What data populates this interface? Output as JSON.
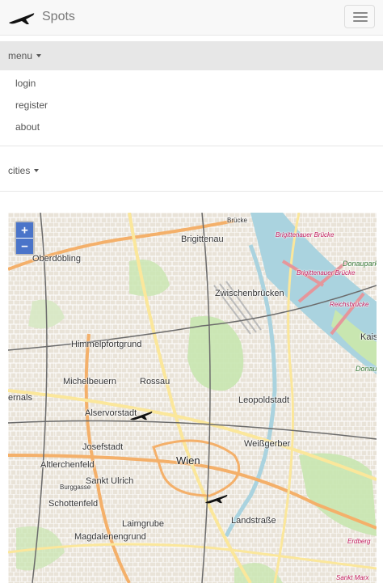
{
  "navbar": {
    "brand": "Spots",
    "brand_icon": "airplane-icon",
    "toggle_icon": "hamburger-icon"
  },
  "menu": {
    "label": "menu",
    "items": [
      {
        "label": "login"
      },
      {
        "label": "register"
      },
      {
        "label": "about"
      }
    ]
  },
  "cities": {
    "label": "cities"
  },
  "map": {
    "zoom_in": "+",
    "zoom_out": "−",
    "labels": [
      {
        "text": "Oberdöbling",
        "cls": ""
      },
      {
        "text": "Brigittenau",
        "cls": ""
      },
      {
        "text": "Brücke",
        "cls": "small"
      },
      {
        "text": "Brigittenauer Brücke",
        "cls": "red"
      },
      {
        "text": "Brigittenauer Brücke",
        "cls": "red"
      },
      {
        "text": "Zwischenbrücken",
        "cls": ""
      },
      {
        "text": "Reichsbrücke",
        "cls": "red"
      },
      {
        "text": "Kais",
        "cls": ""
      },
      {
        "text": "Himmelpfortgrund",
        "cls": ""
      },
      {
        "text": "Michelbeuern",
        "cls": ""
      },
      {
        "text": "Rossau",
        "cls": ""
      },
      {
        "text": "Leopoldstadt",
        "cls": ""
      },
      {
        "text": "ernals",
        "cls": ""
      },
      {
        "text": "Alservorstadt",
        "cls": ""
      },
      {
        "text": "Josefstadt",
        "cls": ""
      },
      {
        "text": "Weißgerber",
        "cls": ""
      },
      {
        "text": "Wien",
        "cls": "big"
      },
      {
        "text": "Altlerchenfeld",
        "cls": ""
      },
      {
        "text": "Sankt Ulrich",
        "cls": ""
      },
      {
        "text": "Burggasse",
        "cls": "small"
      },
      {
        "text": "Schottenfeld",
        "cls": ""
      },
      {
        "text": "Landstraße",
        "cls": ""
      },
      {
        "text": "Laimgrube",
        "cls": ""
      },
      {
        "text": "Magdalenengrund",
        "cls": ""
      },
      {
        "text": "Erdberg",
        "cls": "red"
      },
      {
        "text": "Sankt Marx",
        "cls": "red"
      },
      {
        "text": "Donaupark",
        "cls": "green"
      },
      {
        "text": "Donau",
        "cls": "green"
      }
    ]
  },
  "colors": {
    "navbar_bg": "#f8f8f8",
    "menu_header_bg": "#e7e7e7",
    "zoom_button": "#4a74c9",
    "river": "#aad3df",
    "park": "#c8e6b0",
    "main_road": "#f4b06a",
    "secondary_road": "#fbe79b"
  }
}
